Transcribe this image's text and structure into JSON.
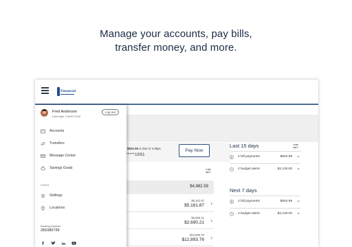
{
  "headline": {
    "line1": "Manage your accounts, pay bills,",
    "line2": "transfer money, and more."
  },
  "app": {
    "logo_text": "Financial"
  },
  "user": {
    "name": "Fred Anderson",
    "last_login": "Last login: 9 AUG 2018",
    "logout_label": "Log out"
  },
  "nav": {
    "items": [
      {
        "label": "Accounts",
        "icon": "accounts-icon"
      },
      {
        "label": "Transfers",
        "icon": "transfers-icon"
      },
      {
        "label": "Message Center",
        "icon": "mail-icon"
      },
      {
        "label": "Savings Goals",
        "icon": "piggy-bank-icon"
      }
    ],
    "links_label": "LINKS",
    "links": [
      {
        "label": "Settings",
        "icon": "gear-icon"
      },
      {
        "label": "Locations",
        "icon": "location-pin-icon"
      }
    ],
    "routing_label": "Routing Number",
    "routing_number": "281080739",
    "social": [
      "facebook-icon",
      "twitter-icon",
      "linkedin-icon",
      "youtube-icon"
    ]
  },
  "main": {
    "title_fragment": "l",
    "due": {
      "amount": "$621.84",
      "suffix": " is due in 3 days",
      "account_mask": "*****1891",
      "pay_label": "Pay Now"
    },
    "total": "$4,982.59",
    "accounts": [
      {
        "small": "$5,161.87",
        "big": "$5,161.87"
      },
      {
        "small": "$2,690.21",
        "big": "$2,690.21"
      },
      {
        "small": "$12,893.76",
        "big": "$12,893.76"
      }
    ]
  },
  "upcoming": [
    {
      "title": "Last 15 days",
      "rows": [
        {
          "label": "2 bill payments",
          "amount": "$604.99",
          "icon": "dollar-circle-icon"
        },
        {
          "label": "2 budget alerts",
          "amount": "$2,130.00",
          "icon": "clock-icon"
        }
      ]
    },
    {
      "title": "Next 7 days",
      "rows": [
        {
          "label": "2 bill payments",
          "amount": "$604.99",
          "icon": "dollar-circle-icon"
        },
        {
          "label": "2 budget alerts",
          "amount": "$2,130.00",
          "icon": "clock-icon"
        }
      ]
    }
  ],
  "colors": {
    "brand": "#1d4e89",
    "accent_bar": "#4a6a8e",
    "heading": "#1b2a44"
  }
}
